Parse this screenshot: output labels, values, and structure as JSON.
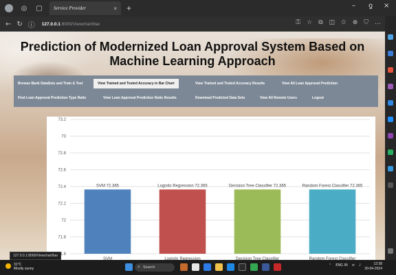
{
  "browser": {
    "tab_title": "Service Provider",
    "tab_close": "×",
    "new_tab": "+",
    "url_host": "127.0.0.1",
    "url_path": ":8000/Viewchart/bar",
    "window_min": "–",
    "window_max": "ƍ",
    "window_close": "×"
  },
  "page": {
    "title": "Prediction of Modernized Loan Approval System Based on Machine Learning Approach"
  },
  "menu": {
    "items": [
      {
        "label": "Browse Bank DataSets and Train & Test",
        "active": false
      },
      {
        "label": "View Trained and Tested Accuracy in Bar Chart",
        "active": true
      },
      {
        "label": "View Trained and Tested Accuracy Results",
        "active": false
      },
      {
        "label": "View All Loan Approval Prediction",
        "active": false
      },
      {
        "label": "Find Loan Approval Prediction Type Ratio",
        "active": false
      },
      {
        "label": "View Loan Approval Prediction Ratio Results",
        "active": false
      },
      {
        "label": "Download Predicted Data Sets",
        "active": false
      },
      {
        "label": "View All Remote Users",
        "active": false
      },
      {
        "label": "Logout",
        "active": false
      }
    ]
  },
  "chart_data": {
    "type": "bar",
    "categories": [
      "SVM",
      "Logistic Regression",
      "Decision Tree Classifier",
      "Random Forest Classifier"
    ],
    "values": [
      72.365,
      72.365,
      72.365,
      72.365
    ],
    "data_labels": [
      "SVM 72.365",
      "Logistic Regression 72.365",
      "Decision Tree Classifier 72.365",
      "Random Forest Classifier 72.365"
    ],
    "colors": [
      "#4f81bd",
      "#c0504d",
      "#9bbb59",
      "#4bacc6"
    ],
    "ylim": [
      71.6,
      73.2
    ],
    "yticks": [
      "73.2",
      "73",
      "72.8",
      "72.6",
      "72.4",
      "72.2",
      "72",
      "71.8",
      "71.6"
    ],
    "grid": true,
    "title": "",
    "xlabel": "",
    "ylabel": ""
  },
  "statusbar": {
    "url": "127.0.0.1:8000/Viewchart/bar"
  },
  "taskbar": {
    "weather_temp": "31°C",
    "weather_text": "Mostly sunny",
    "search_placeholder": "Search",
    "time": "12:38",
    "date": "30-04-2024",
    "lang": "ENG IN"
  }
}
